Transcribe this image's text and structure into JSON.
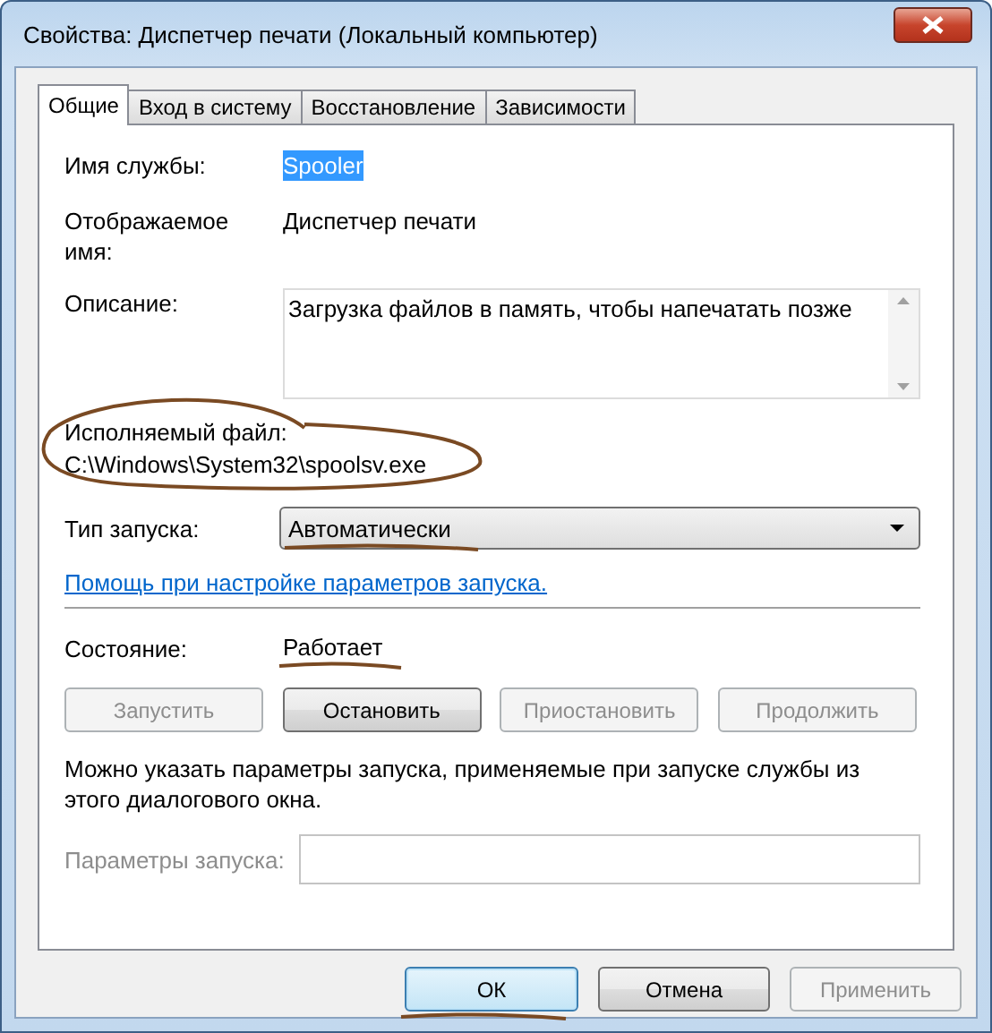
{
  "window": {
    "title": "Свойства: Диспетчер печати (Локальный компьютер)"
  },
  "tabs": [
    {
      "label": "Общие",
      "selected": true
    },
    {
      "label": "Вход в систему",
      "selected": false
    },
    {
      "label": "Восстановление",
      "selected": false
    },
    {
      "label": "Зависимости",
      "selected": false
    }
  ],
  "service_name": {
    "label": "Имя службы:",
    "value": "Spooler",
    "selected": true
  },
  "display_name": {
    "label": "Отображаемое имя:",
    "value": "Диспетчер печати"
  },
  "description": {
    "label": "Описание:",
    "value": "Загрузка файлов в память, чтобы напечатать позже"
  },
  "executable": {
    "label": "Исполняемый файл:",
    "value": "C:\\Windows\\System32\\spoolsv.exe",
    "circled": true
  },
  "startup_type": {
    "label": "Тип запуска:",
    "value": "Автоматически",
    "underlined": true
  },
  "help_link": "Помощь при настройке параметров запуска.",
  "status": {
    "label": "Состояние:",
    "value": "Работает",
    "underlined": true
  },
  "service_buttons": [
    {
      "label": "Запустить",
      "disabled": true
    },
    {
      "label": "Остановить",
      "disabled": false
    },
    {
      "label": "Приостановить",
      "disabled": true
    },
    {
      "label": "Продолжить",
      "disabled": true
    }
  ],
  "params_hint": "Можно указать параметры запуска, применяемые при запуске службы из этого диалогового окна.",
  "start_params": {
    "label": "Параметры запуска:",
    "disabled": true
  },
  "dialog_buttons": [
    {
      "label": "ОК",
      "disabled": false,
      "default": true,
      "underlined": true
    },
    {
      "label": "Отмена",
      "disabled": false,
      "default": false
    },
    {
      "label": "Применить",
      "disabled": true,
      "default": false
    }
  ]
}
